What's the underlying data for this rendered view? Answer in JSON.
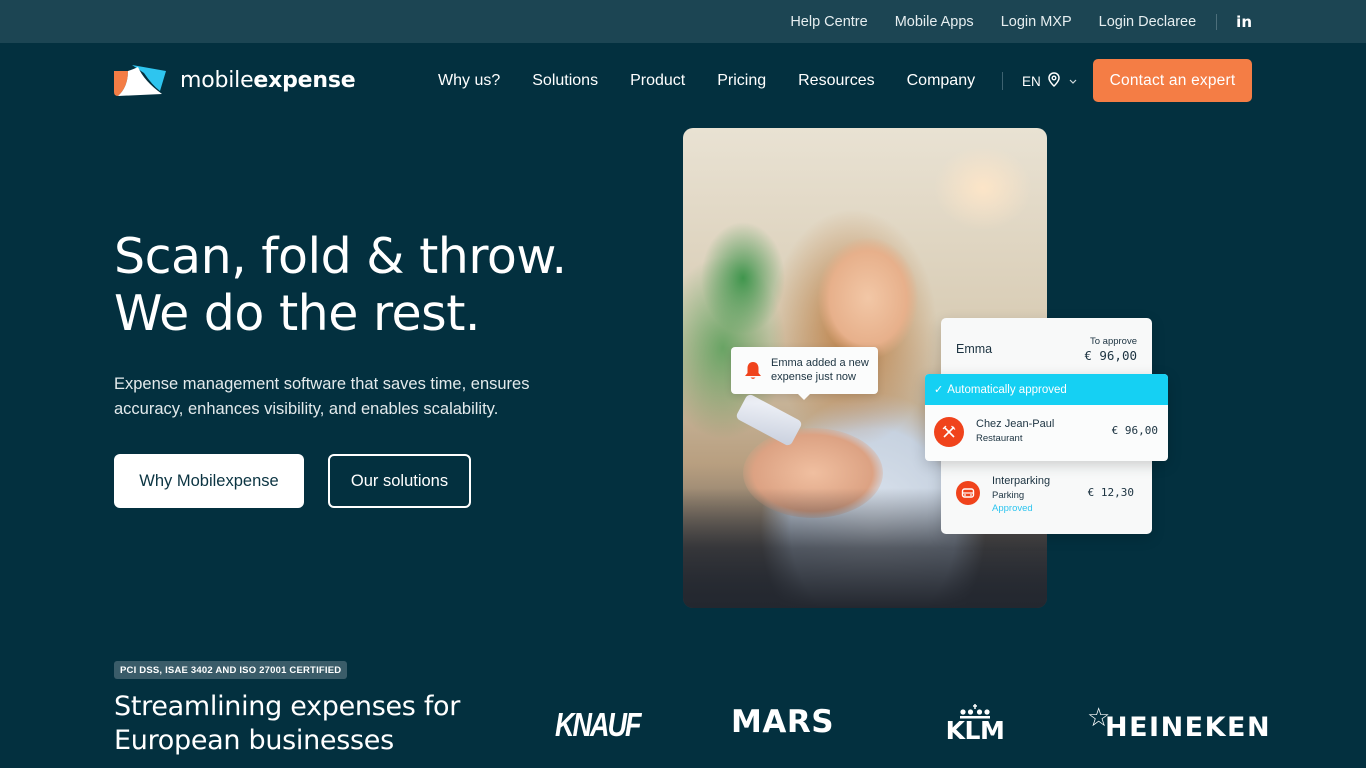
{
  "topbar": {
    "links": [
      "Help Centre",
      "Mobile Apps",
      "Login MXP",
      "Login Declaree"
    ],
    "social_icon": "linkedin-icon",
    "social_label": "in"
  },
  "nav": {
    "logo": {
      "light": "mobile",
      "bold": "expense"
    },
    "items": [
      "Why us?",
      "Solutions",
      "Product",
      "Pricing",
      "Resources",
      "Company"
    ],
    "language": "EN",
    "language_icons": [
      "location-pin-icon",
      "chevron-down-icon"
    ],
    "cta": "Contact an expert"
  },
  "hero": {
    "title_line1": "Scan, fold & throw.",
    "title_line2": "We do the rest.",
    "subtitle": "Expense management software that saves time, ensures accuracy, enhances visibility, and enables scalability.",
    "primary_button": "Why Mobilexpense",
    "secondary_button": "Our solutions"
  },
  "illustration": {
    "notification": {
      "icon": "bell-icon",
      "text_line1": "Emma added a new",
      "text_line2": "expense just now"
    },
    "approval_card": {
      "user": "Emma",
      "status": "To approve",
      "total": "€ 96,00"
    },
    "highlight": {
      "banner": "Automatically approved",
      "banner_icon": "checkmark-icon",
      "merchant": "Chez Jean-Paul",
      "category": "Restaurant",
      "category_icon": "fork-knife-icon",
      "amount": "€ 96,00"
    },
    "second_expense": {
      "merchant": "Interparking",
      "category": "Parking",
      "category_icon": "car-icon",
      "status": "Approved",
      "amount": "€ 12,30"
    }
  },
  "trust": {
    "badge": "PCI DSS, ISAE 3402 AND ISO 27001 CERTIFIED",
    "title_line1": "Streamlining expenses for",
    "title_line2": "European businesses",
    "logos": [
      "KNAUF",
      "MARS",
      "KLM",
      "HEINEKEN"
    ]
  },
  "colors": {
    "background": "#03303f",
    "topbar": "#1c4553",
    "accent": "#f47d45",
    "approved_banner": "#15d0f3",
    "category_icon": "#f0431c"
  }
}
